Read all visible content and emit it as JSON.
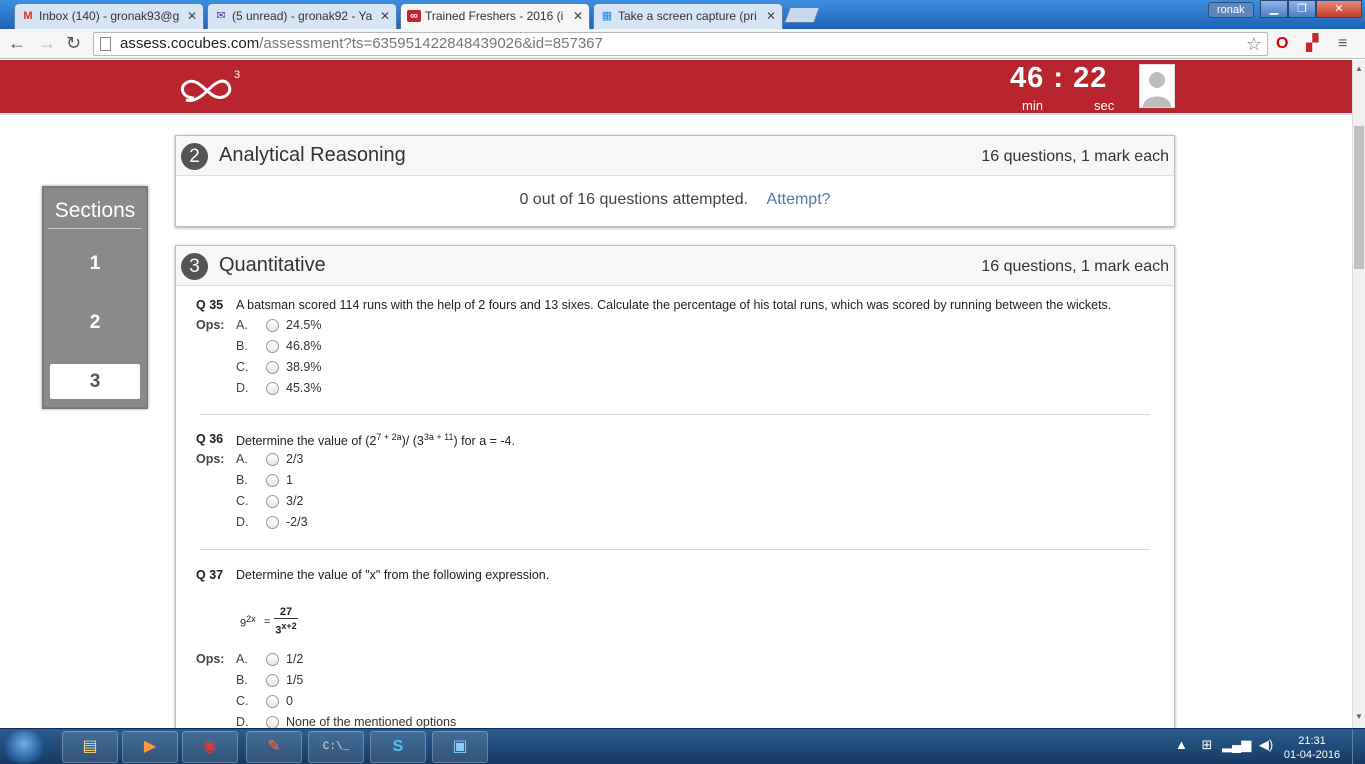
{
  "browser": {
    "tabs": [
      {
        "title": "Inbox (140) - gronak93@g",
        "icon": "gmail-icon"
      },
      {
        "title": "(5 unread) - gronak92 - Ya",
        "icon": "yahoo-mail-icon"
      },
      {
        "title": "Trained Freshers - 2016 (i",
        "icon": "cocubes-icon"
      },
      {
        "title": "Take a screen capture (pri",
        "icon": "windows-icon"
      }
    ],
    "user": "ronak",
    "url_host": "assess.cocubes.com",
    "url_path": "/assessment?ts=635951422848439026&id=857367"
  },
  "header": {
    "logo_sup": "3",
    "timer_min": "46",
    "timer_sep": ":",
    "timer_sec": "22",
    "min_label": "min",
    "sec_label": "sec"
  },
  "sidebar": {
    "title": "Sections",
    "items": [
      {
        "label": "1",
        "active": false
      },
      {
        "label": "2",
        "active": false
      },
      {
        "label": "3",
        "active": true
      }
    ]
  },
  "sections": [
    {
      "num": "2",
      "title": "Analytical Reasoning",
      "meta_count": "16 questions",
      "meta_sep": ",",
      "meta_marks": " 1 mark each",
      "status": "0 out of 16 questions attempted.",
      "attempt_link": "Attempt?"
    },
    {
      "num": "3",
      "title": "Quantitative",
      "meta_count": "16 questions",
      "meta_sep": ",",
      "meta_marks": " 1 mark each"
    }
  ],
  "questions": [
    {
      "num": "Q 35",
      "text": "A batsman scored 114 runs with the help of 2 fours and 13 sixes. Calculate the percentage of his total runs, which was scored by running between the wickets.",
      "ops_label": "Ops:",
      "options": [
        {
          "letter": "A.",
          "text": "24.5%"
        },
        {
          "letter": "B.",
          "text": "46.8%"
        },
        {
          "letter": "C.",
          "text": "38.9%"
        },
        {
          "letter": "D.",
          "text": "45.3%"
        }
      ]
    },
    {
      "num": "Q 36",
      "text_a": "Determine the value of (2",
      "sup_a": "7 + 2a",
      "text_b": ")/ (3",
      "sup_b": "3a + 11",
      "text_c": ") for a = -4.",
      "ops_label": "Ops:",
      "options": [
        {
          "letter": "A.",
          "text": "2/3"
        },
        {
          "letter": "B.",
          "text": "1"
        },
        {
          "letter": "C.",
          "text": "3/2"
        },
        {
          "letter": "D.",
          "text": "-2/3"
        }
      ]
    },
    {
      "num": "Q 37",
      "text": "Determine the value of \"x\" from the following expression.",
      "expr_base": "9",
      "expr_exp": "2x",
      "expr_eq": "=",
      "expr_num": "27",
      "expr_den_base": "3",
      "expr_den_exp": "x+2",
      "ops_label": "Ops:",
      "options": [
        {
          "letter": "A.",
          "text": "1/2"
        },
        {
          "letter": "B.",
          "text": "1/5"
        },
        {
          "letter": "C.",
          "text": "0"
        },
        {
          "letter": "D.",
          "text": "None of the mentioned options"
        }
      ]
    }
  ],
  "taskbar": {
    "time": "21:31",
    "date": "01-04-2016",
    "items": [
      "explorer-icon",
      "media-player-icon",
      "chrome-icon",
      "eraser-app-icon",
      "cmd-icon",
      "skype-icon",
      "screenshot-app-icon"
    ]
  },
  "colors": {
    "brand": "#b8252f",
    "link": "#4f78b0",
    "sidebar": "#8a8a8a"
  }
}
